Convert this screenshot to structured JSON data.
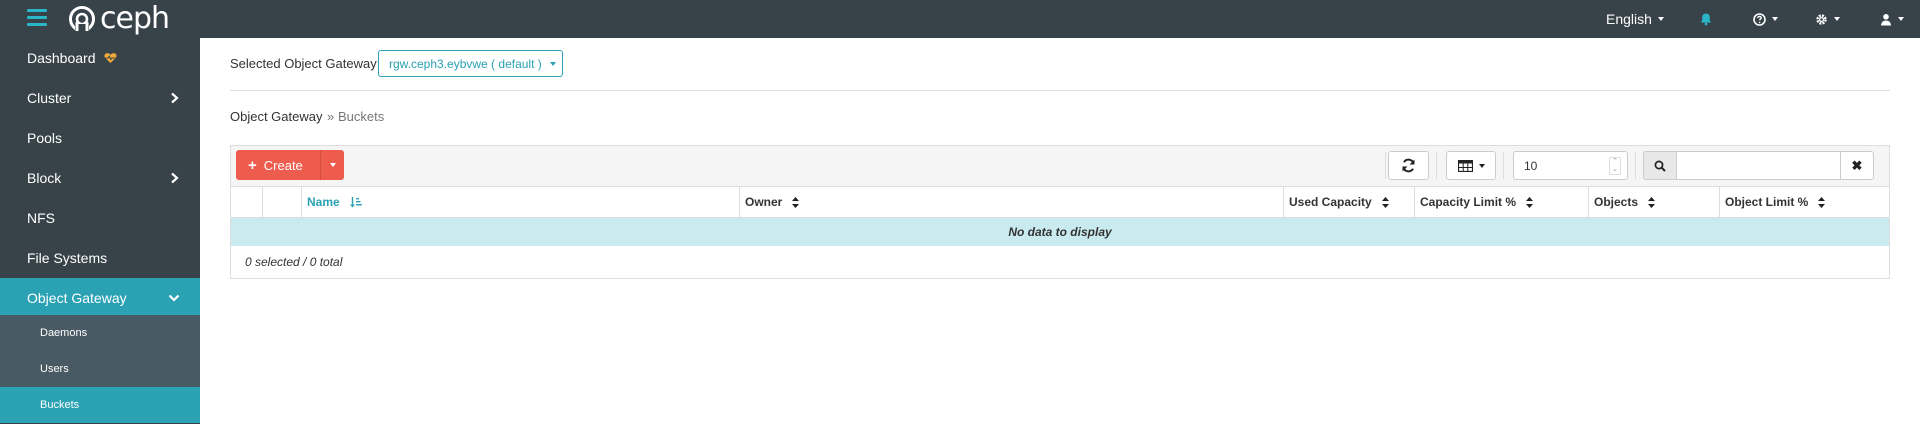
{
  "brand": {
    "name": "ceph"
  },
  "navbar": {
    "language": "English",
    "icons": [
      "menu-icon",
      "notification-bell-icon",
      "help-icon",
      "settings-gear-icon",
      "user-icon"
    ]
  },
  "sidebar": {
    "items": [
      {
        "label": "Dashboard",
        "icon": "heart-health-icon"
      },
      {
        "label": "Cluster",
        "icon": "chevron-right-icon"
      },
      {
        "label": "Pools"
      },
      {
        "label": "Block",
        "icon": "chevron-right-icon"
      },
      {
        "label": "NFS"
      },
      {
        "label": "File Systems"
      },
      {
        "label": "Object Gateway",
        "icon": "chevron-down-icon",
        "active": true
      }
    ],
    "subitems": [
      {
        "label": "Daemons"
      },
      {
        "label": "Users"
      },
      {
        "label": "Buckets",
        "active": true
      }
    ]
  },
  "gateway": {
    "label": "Selected Object Gateway:",
    "selected": "rgw.ceph3.eybvwe ( default )"
  },
  "breadcrumb": {
    "parent": "Object Gateway",
    "separator": "»",
    "current": "Buckets"
  },
  "toolbar": {
    "create_label": "Create",
    "page_size": "10",
    "search_placeholder": ""
  },
  "table": {
    "columns": [
      "Name",
      "Owner",
      "Used Capacity",
      "Capacity Limit %",
      "Objects",
      "Object Limit %"
    ],
    "sorted_column": "Name",
    "empty_message": "No data to display",
    "footer": "0 selected / 0 total"
  },
  "colors": {
    "navbar": "#374249",
    "accent": "#2aa2b4",
    "create_button": "#ee5c4d",
    "empty_row": "#c9ebf0"
  }
}
